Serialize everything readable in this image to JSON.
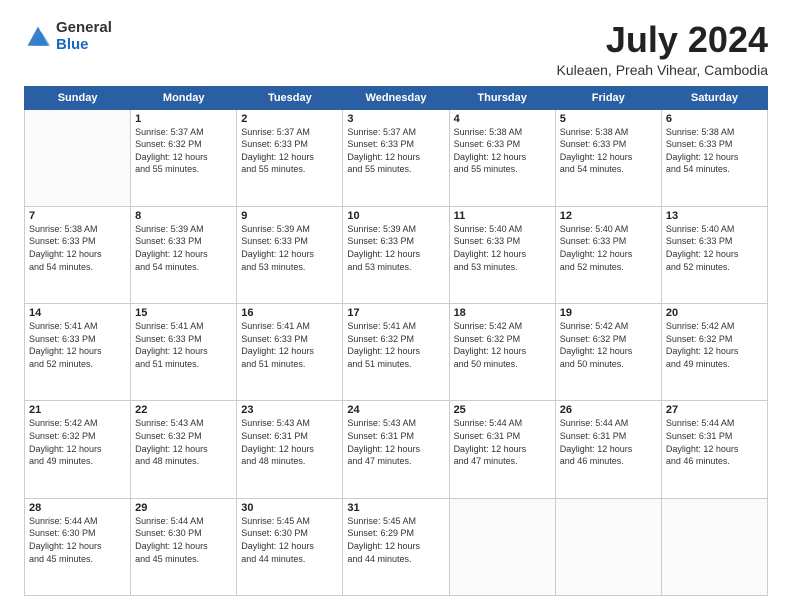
{
  "logo": {
    "general": "General",
    "blue": "Blue"
  },
  "header": {
    "month": "July 2024",
    "location": "Kuleaen, Preah Vihear, Cambodia"
  },
  "weekdays": [
    "Sunday",
    "Monday",
    "Tuesday",
    "Wednesday",
    "Thursday",
    "Friday",
    "Saturday"
  ],
  "weeks": [
    [
      {
        "day": "",
        "info": ""
      },
      {
        "day": "1",
        "info": "Sunrise: 5:37 AM\nSunset: 6:32 PM\nDaylight: 12 hours\nand 55 minutes."
      },
      {
        "day": "2",
        "info": "Sunrise: 5:37 AM\nSunset: 6:33 PM\nDaylight: 12 hours\nand 55 minutes."
      },
      {
        "day": "3",
        "info": "Sunrise: 5:37 AM\nSunset: 6:33 PM\nDaylight: 12 hours\nand 55 minutes."
      },
      {
        "day": "4",
        "info": "Sunrise: 5:38 AM\nSunset: 6:33 PM\nDaylight: 12 hours\nand 55 minutes."
      },
      {
        "day": "5",
        "info": "Sunrise: 5:38 AM\nSunset: 6:33 PM\nDaylight: 12 hours\nand 54 minutes."
      },
      {
        "day": "6",
        "info": "Sunrise: 5:38 AM\nSunset: 6:33 PM\nDaylight: 12 hours\nand 54 minutes."
      }
    ],
    [
      {
        "day": "7",
        "info": "Sunrise: 5:38 AM\nSunset: 6:33 PM\nDaylight: 12 hours\nand 54 minutes."
      },
      {
        "day": "8",
        "info": "Sunrise: 5:39 AM\nSunset: 6:33 PM\nDaylight: 12 hours\nand 54 minutes."
      },
      {
        "day": "9",
        "info": "Sunrise: 5:39 AM\nSunset: 6:33 PM\nDaylight: 12 hours\nand 53 minutes."
      },
      {
        "day": "10",
        "info": "Sunrise: 5:39 AM\nSunset: 6:33 PM\nDaylight: 12 hours\nand 53 minutes."
      },
      {
        "day": "11",
        "info": "Sunrise: 5:40 AM\nSunset: 6:33 PM\nDaylight: 12 hours\nand 53 minutes."
      },
      {
        "day": "12",
        "info": "Sunrise: 5:40 AM\nSunset: 6:33 PM\nDaylight: 12 hours\nand 52 minutes."
      },
      {
        "day": "13",
        "info": "Sunrise: 5:40 AM\nSunset: 6:33 PM\nDaylight: 12 hours\nand 52 minutes."
      }
    ],
    [
      {
        "day": "14",
        "info": "Sunrise: 5:41 AM\nSunset: 6:33 PM\nDaylight: 12 hours\nand 52 minutes."
      },
      {
        "day": "15",
        "info": "Sunrise: 5:41 AM\nSunset: 6:33 PM\nDaylight: 12 hours\nand 51 minutes."
      },
      {
        "day": "16",
        "info": "Sunrise: 5:41 AM\nSunset: 6:33 PM\nDaylight: 12 hours\nand 51 minutes."
      },
      {
        "day": "17",
        "info": "Sunrise: 5:41 AM\nSunset: 6:32 PM\nDaylight: 12 hours\nand 51 minutes."
      },
      {
        "day": "18",
        "info": "Sunrise: 5:42 AM\nSunset: 6:32 PM\nDaylight: 12 hours\nand 50 minutes."
      },
      {
        "day": "19",
        "info": "Sunrise: 5:42 AM\nSunset: 6:32 PM\nDaylight: 12 hours\nand 50 minutes."
      },
      {
        "day": "20",
        "info": "Sunrise: 5:42 AM\nSunset: 6:32 PM\nDaylight: 12 hours\nand 49 minutes."
      }
    ],
    [
      {
        "day": "21",
        "info": "Sunrise: 5:42 AM\nSunset: 6:32 PM\nDaylight: 12 hours\nand 49 minutes."
      },
      {
        "day": "22",
        "info": "Sunrise: 5:43 AM\nSunset: 6:32 PM\nDaylight: 12 hours\nand 48 minutes."
      },
      {
        "day": "23",
        "info": "Sunrise: 5:43 AM\nSunset: 6:31 PM\nDaylight: 12 hours\nand 48 minutes."
      },
      {
        "day": "24",
        "info": "Sunrise: 5:43 AM\nSunset: 6:31 PM\nDaylight: 12 hours\nand 47 minutes."
      },
      {
        "day": "25",
        "info": "Sunrise: 5:44 AM\nSunset: 6:31 PM\nDaylight: 12 hours\nand 47 minutes."
      },
      {
        "day": "26",
        "info": "Sunrise: 5:44 AM\nSunset: 6:31 PM\nDaylight: 12 hours\nand 46 minutes."
      },
      {
        "day": "27",
        "info": "Sunrise: 5:44 AM\nSunset: 6:31 PM\nDaylight: 12 hours\nand 46 minutes."
      }
    ],
    [
      {
        "day": "28",
        "info": "Sunrise: 5:44 AM\nSunset: 6:30 PM\nDaylight: 12 hours\nand 45 minutes."
      },
      {
        "day": "29",
        "info": "Sunrise: 5:44 AM\nSunset: 6:30 PM\nDaylight: 12 hours\nand 45 minutes."
      },
      {
        "day": "30",
        "info": "Sunrise: 5:45 AM\nSunset: 6:30 PM\nDaylight: 12 hours\nand 44 minutes."
      },
      {
        "day": "31",
        "info": "Sunrise: 5:45 AM\nSunset: 6:29 PM\nDaylight: 12 hours\nand 44 minutes."
      },
      {
        "day": "",
        "info": ""
      },
      {
        "day": "",
        "info": ""
      },
      {
        "day": "",
        "info": ""
      }
    ]
  ]
}
